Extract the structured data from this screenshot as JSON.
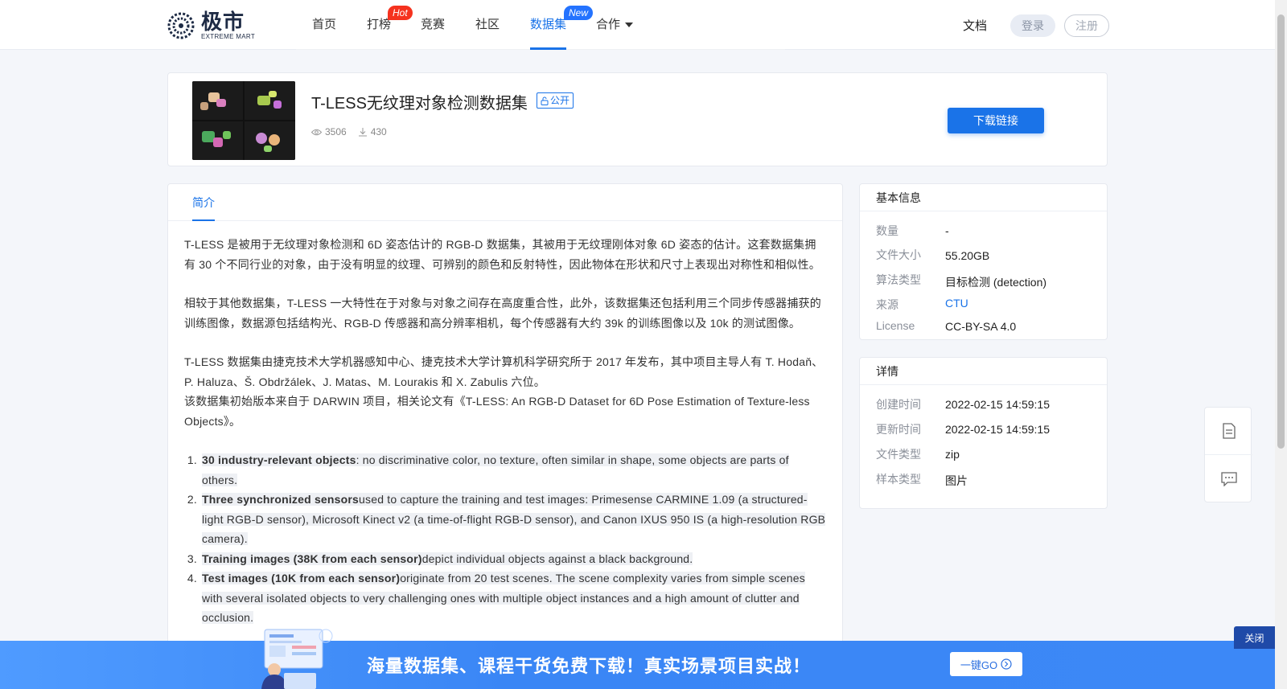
{
  "header": {
    "logo_cn": "极市",
    "logo_en": "EXTREME MART",
    "nav": [
      {
        "label": "首页"
      },
      {
        "label": "打榜",
        "badge": "Hot"
      },
      {
        "label": "竞赛"
      },
      {
        "label": "社区"
      },
      {
        "label": "数据集",
        "badge": "New",
        "active": true
      },
      {
        "label": "合作"
      }
    ],
    "doc_label": "文档",
    "login_label": "登录",
    "register_label": "注册"
  },
  "dataset": {
    "title": "T-LESS无纹理对象检测数据集",
    "visibility": "公开",
    "views": "3506",
    "downloads": "430",
    "download_button": "下载链接"
  },
  "tabs": [
    {
      "label": "简介",
      "active": true
    }
  ],
  "intro": {
    "p1": "T-LESS 是被用于无纹理对象检测和 6D 姿态估计的 RGB-D 数据集，其被用于无纹理刚体对象 6D 姿态的估计。这套数据集拥有 30 个不同行业的对象，由于没有明显的纹理、可辨别的颜色和反射特性，因此物体在形状和尺寸上表现出对称性和相似性。",
    "p2": "相较于其他数据集，T-LESS 一大特性在于对象与对象之间存在高度重合性，此外，该数据集还包括利用三个同步传感器捕获的训练图像，数据源包括结构光、RGB-D 传感器和高分辨率相机，每个传感器有大约 39k 的训练图像以及 10k 的测试图像。",
    "p3": "T-LESS 数据集由捷克技术大学机器感知中心、捷克技术大学计算机科学研究所于 2017 年发布，其中项目主导人有 T. Hodaň、P. Haluza、Š. Obdržálek、J. Matas、M. Lourakis 和 X. Zabulis 六位。",
    "p4": "该数据集初始版本来自于 DARWIN 项目，相关论文有《T-LESS: An RGB-D Dataset for 6D Pose Estimation of Texture-less Objects》。",
    "items": [
      {
        "bold": "30 industry-relevant objects",
        "text": ": no discriminative color, no texture, often similar in shape, some objects are parts of others."
      },
      {
        "bold": "Three synchronized sensors",
        "text": "used to capture the training and test images: Primesense CARMINE 1.09 (a structured-light RGB-D sensor), Microsoft Kinect v2 (a time-of-flight RGB-D sensor), and Canon IXUS 950 IS (a high-resolution RGB camera)."
      },
      {
        "bold": "Training images (38K from each sensor)",
        "text": "depict individual objects against a black background."
      },
      {
        "bold": "Test images (10K from each sensor)",
        "text": "originate from 20 test scenes. The scene complexity varies from simple scenes with several isolated objects to very challenging ones with multiple object instances and a high amount of clutter and occlusion."
      }
    ]
  },
  "basic_info": {
    "title": "基本信息",
    "rows": [
      {
        "key": "数量",
        "value": "-"
      },
      {
        "key": "文件大小",
        "value": "55.20GB"
      },
      {
        "key": "算法类型",
        "value": "目标检测 (detection)"
      },
      {
        "key": "来源",
        "value": "CTU"
      },
      {
        "key": "License",
        "value": "CC-BY-SA 4.0"
      }
    ]
  },
  "details": {
    "title": "详情",
    "rows": [
      {
        "key": "创建时间",
        "value": "2022-02-15 14:59:15"
      },
      {
        "key": "更新时间",
        "value": "2022-02-15 14:59:15"
      },
      {
        "key": "文件类型",
        "value": "zip"
      },
      {
        "key": "样本类型",
        "value": "图片"
      }
    ]
  },
  "promo": {
    "text": "海量数据集、课程干货免费下载！真实场景项目实战！",
    "go_label": "一键GO",
    "close_label": "关闭"
  },
  "colors": {
    "accent": "#1a73e8",
    "hot": "#f5321e",
    "new": "#2473ff",
    "promo": "#3a86f5"
  }
}
